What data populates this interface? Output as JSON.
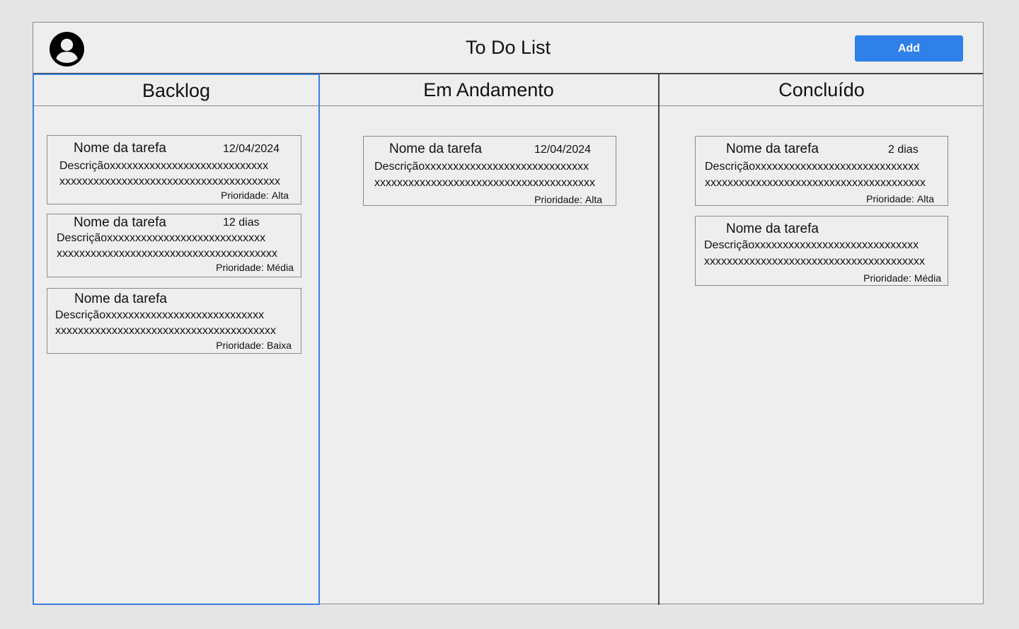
{
  "header": {
    "title": "To Do List",
    "add_label": "Add"
  },
  "columns": [
    {
      "title": "Backlog",
      "cards": [
        {
          "name": "Nome da tarefa",
          "meta": "12/04/2024",
          "desc1": "Descriçãoxxxxxxxxxxxxxxxxxxxxxxxxxxxx",
          "desc2": "xxxxxxxxxxxxxxxxxxxxxxxxxxxxxxxxxxxxxxx",
          "prio_label": "Prioridade:",
          "prio_value": "Alta"
        },
        {
          "name": "Nome da tarefa",
          "meta": "12 dias",
          "desc1": "Descriçãoxxxxxxxxxxxxxxxxxxxxxxxxxxxx",
          "desc2": "xxxxxxxxxxxxxxxxxxxxxxxxxxxxxxxxxxxxxxx",
          "prio_label": "Prioridade:",
          "prio_value": "Média"
        },
        {
          "name": "Nome da tarefa",
          "meta": "",
          "desc1": "Descriçãoxxxxxxxxxxxxxxxxxxxxxxxxxxxx",
          "desc2": "xxxxxxxxxxxxxxxxxxxxxxxxxxxxxxxxxxxxxxx",
          "prio_label": "Prioridade:",
          "prio_value": "Baixa"
        }
      ]
    },
    {
      "title": "Em Andamento",
      "cards": [
        {
          "name": "Nome da tarefa",
          "meta": "12/04/2024",
          "desc1": "Descriçãoxxxxxxxxxxxxxxxxxxxxxxxxxxxxx",
          "desc2": "xxxxxxxxxxxxxxxxxxxxxxxxxxxxxxxxxxxxxxx",
          "prio_label": "Prioridade:",
          "prio_value": "Alta"
        }
      ]
    },
    {
      "title": "Concluído",
      "cards": [
        {
          "name": "Nome da tarefa",
          "meta": "2 dias",
          "desc1": "Descriçãoxxxxxxxxxxxxxxxxxxxxxxxxxxxxx",
          "desc2": "xxxxxxxxxxxxxxxxxxxxxxxxxxxxxxxxxxxxxxx",
          "prio_label": "Prioridade:",
          "prio_value": "Alta"
        },
        {
          "name": "Nome da tarefa",
          "meta": "",
          "desc1": "Descriçãoxxxxxxxxxxxxxxxxxxxxxxxxxxxxx",
          "desc2": "xxxxxxxxxxxxxxxxxxxxxxxxxxxxxxxxxxxxxxx",
          "prio_label": "Prioridade:",
          "prio_value": "Média"
        }
      ]
    }
  ],
  "colors": {
    "accent": "#2f80e8",
    "selected_border": "#3b7fe0",
    "background": "#eeeeee"
  },
  "icons": {
    "avatar": "user-avatar-icon"
  }
}
